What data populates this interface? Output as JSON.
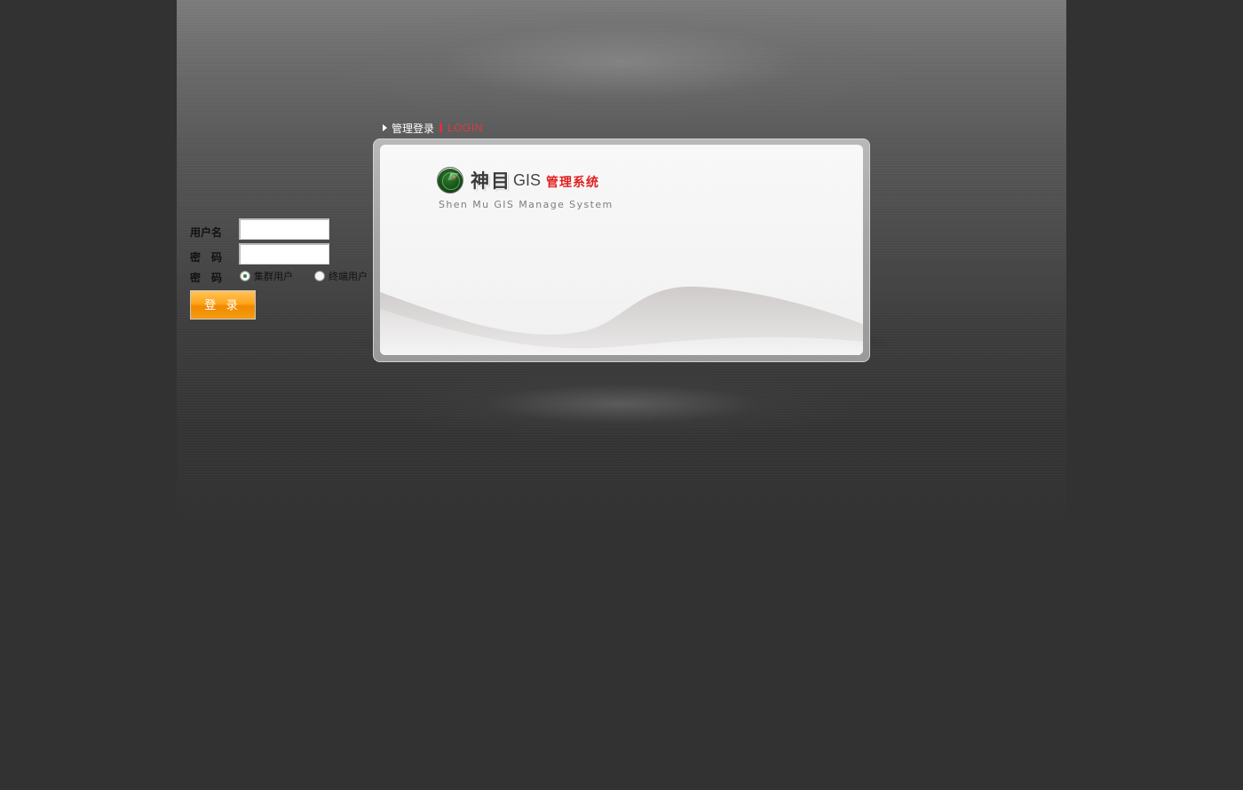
{
  "header": {
    "title_zh": "管理登录",
    "title_en": "LOGIN"
  },
  "form": {
    "username_label": "用户名",
    "username_value": "",
    "password_label": "密　码",
    "password_value": "",
    "type_label": "密　码",
    "radio_options": [
      {
        "label": "集群用户",
        "selected": true
      },
      {
        "label": "终端用户",
        "selected": false
      }
    ],
    "submit_label": "登 录",
    "button_color": "#ffa51a"
  },
  "brand": {
    "name": "神目",
    "gis": "GIS",
    "system": "管理系统",
    "subtitle": "Shen Mu GIS Manage System",
    "accent_color": "#e01e1e",
    "logo_icon": "radar-icon"
  },
  "colors": {
    "background": "#323232",
    "panel_border": "#a3a3a3",
    "panel_fill": "#f4f4f4"
  }
}
